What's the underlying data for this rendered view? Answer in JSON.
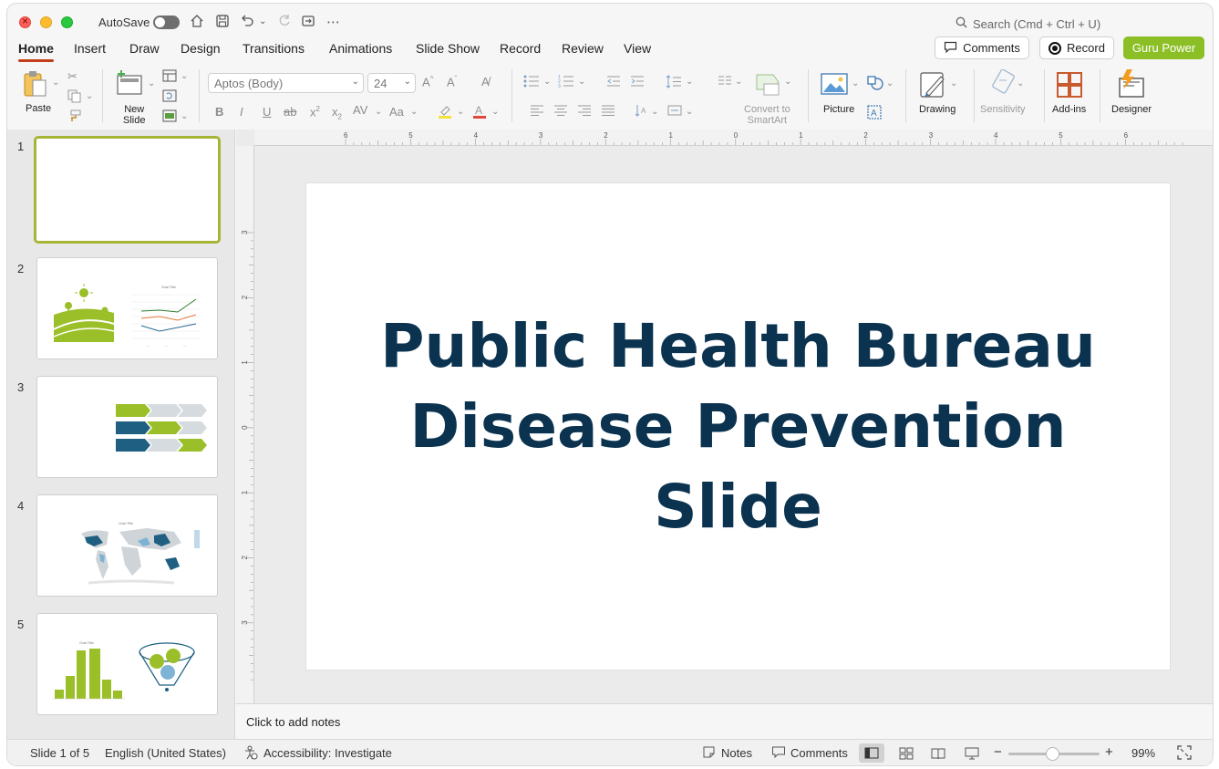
{
  "titlebar": {
    "autosave_label": "AutoSave",
    "search_placeholder": "Search (Cmd + Ctrl + U)"
  },
  "tabs": [
    {
      "label": "Home",
      "active": true
    },
    {
      "label": "Insert"
    },
    {
      "label": "Draw"
    },
    {
      "label": "Design"
    },
    {
      "label": "Transitions"
    },
    {
      "label": "Animations"
    },
    {
      "label": "Slide Show"
    },
    {
      "label": "Record"
    },
    {
      "label": "Review"
    },
    {
      "label": "View"
    }
  ],
  "actions": {
    "comments": "Comments",
    "record": "Record",
    "guru": "Guru Power"
  },
  "ribbon": {
    "paste": "Paste",
    "new_slide_1": "New",
    "new_slide_2": "Slide",
    "font_name": "Aptos (Body)",
    "font_size": "24",
    "convert_1": "Convert to",
    "convert_2": "SmartArt",
    "picture": "Picture",
    "drawing": "Drawing",
    "sensitivity": "Sensitivity",
    "addins": "Add-ins",
    "designer": "Designer"
  },
  "thumbnails": [
    {
      "num": "1"
    },
    {
      "num": "2"
    },
    {
      "num": "3"
    },
    {
      "num": "4"
    },
    {
      "num": "5"
    }
  ],
  "slide": {
    "title_line1": "Public Health Bureau",
    "title_line2": "Disease Prevention",
    "title_line3": "Slide"
  },
  "notes": {
    "placeholder": "Click to add notes"
  },
  "status": {
    "slide_count": "Slide 1 of 5",
    "language": "English (United States)",
    "accessibility": "Accessibility: Investigate",
    "notes": "Notes",
    "comments": "Comments",
    "zoom": "99%"
  },
  "ruler_top_ticks": [
    "6",
    "5",
    "4",
    "3",
    "2",
    "1",
    "0",
    "1",
    "2",
    "3",
    "4",
    "5",
    "6"
  ],
  "ruler_left_ticks": [
    "3",
    "2",
    "1",
    "0",
    "1",
    "2",
    "3"
  ],
  "colors": {
    "accent": "#c43e1c",
    "guru": "#8cbf26",
    "title": "#0b3350",
    "selected_thumb": "#a7b537"
  }
}
